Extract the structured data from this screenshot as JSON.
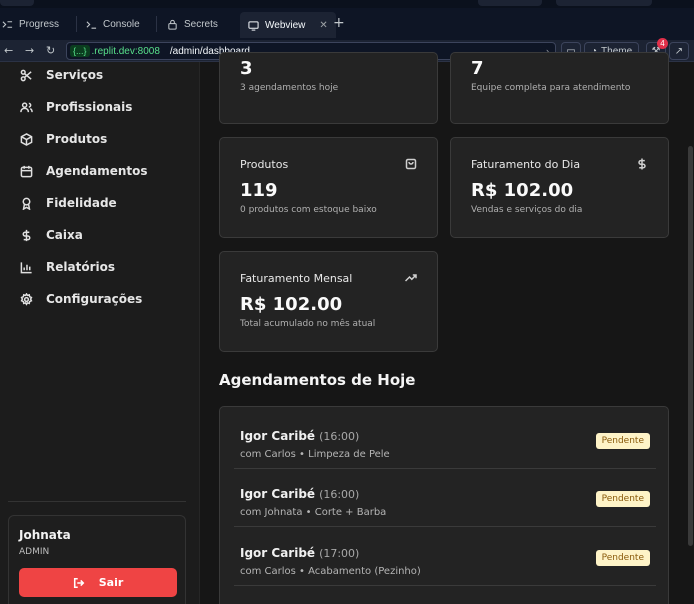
{
  "tabs": [
    {
      "label": "Progress",
      "icon": "progress-icon"
    },
    {
      "label": "Console",
      "icon": "terminal-icon"
    },
    {
      "label": "Secrets",
      "icon": "lock-icon"
    },
    {
      "label": "Webview",
      "icon": "monitor-icon"
    }
  ],
  "browser": {
    "chip": "{...}",
    "host": ".replit.dev:8008",
    "path": "/admin/dashboard",
    "theme_label": "Theme",
    "badge_count": "4"
  },
  "sidebar": {
    "items": [
      {
        "label": "Serviços",
        "icon": "scissors-icon"
      },
      {
        "label": "Profissionais",
        "icon": "users-icon"
      },
      {
        "label": "Produtos",
        "icon": "package-icon"
      },
      {
        "label": "Agendamentos",
        "icon": "calendar-icon"
      },
      {
        "label": "Fidelidade",
        "icon": "award-icon"
      },
      {
        "label": "Caixa",
        "icon": "dollar-icon"
      },
      {
        "label": "Relatórios",
        "icon": "bar-chart-icon"
      },
      {
        "label": "Configurações",
        "icon": "gear-icon"
      }
    ],
    "user": {
      "name": "Johnata",
      "role": "ADMIN"
    },
    "logout_label": "Sair"
  },
  "cards": {
    "appointments": {
      "value": "3",
      "subtitle": "3 agendamentos hoje"
    },
    "team": {
      "value": "7",
      "subtitle": "Equipe completa para atendimento"
    },
    "products": {
      "title": "Produtos",
      "value": "119",
      "subtitle": "0 produtos com estoque baixo",
      "icon": "shopping-bag-icon"
    },
    "daily": {
      "title": "Faturamento do Dia",
      "value": "R$ 102.00",
      "subtitle": "Vendas e serviços do dia",
      "icon": "dollar-icon"
    },
    "monthly": {
      "title": "Faturamento Mensal",
      "value": "R$ 102.00",
      "subtitle": "Total acumulado no mês atual",
      "icon": "trending-up-icon"
    }
  },
  "today": {
    "title": "Agendamentos de Hoje",
    "items": [
      {
        "client": "Igor Caribé",
        "time": "(16:00)",
        "service": "com Carlos • Limpeza de Pele",
        "status": "Pendente"
      },
      {
        "client": "Igor Caribé",
        "time": "(16:00)",
        "service": "com Johnata • Corte + Barba",
        "status": "Pendente"
      },
      {
        "client": "Igor Caribé",
        "time": "(17:00)",
        "service": "com Carlos • Acabamento (Pezinho)",
        "status": "Pendente"
      }
    ]
  }
}
